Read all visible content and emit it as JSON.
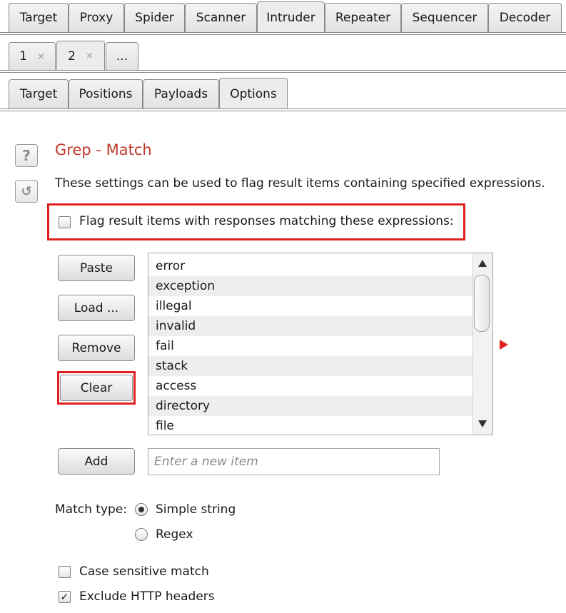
{
  "main_tabs": [
    "Target",
    "Proxy",
    "Spider",
    "Scanner",
    "Intruder",
    "Repeater",
    "Sequencer",
    "Decoder"
  ],
  "attack_tabs": [
    {
      "label": "1",
      "close": "×"
    },
    {
      "label": "2",
      "close": "×"
    },
    {
      "label": "..."
    }
  ],
  "sub_tabs": [
    "Target",
    "Positions",
    "Payloads",
    "Options"
  ],
  "section": {
    "title": "Grep - Match",
    "description": "These settings can be used to flag result items containing specified expressions.",
    "flag_label": "Flag result items with responses matching these expressions:"
  },
  "buttons": {
    "paste": "Paste",
    "load": "Load ...",
    "remove": "Remove",
    "clear": "Clear",
    "add": "Add"
  },
  "list_items": [
    "error",
    "exception",
    "illegal",
    "invalid",
    "fail",
    "stack",
    "access",
    "directory",
    "file"
  ],
  "new_item_placeholder": "Enter a new item",
  "match_type": {
    "label": "Match type:",
    "options": [
      "Simple string",
      "Regex"
    ],
    "selected": "Simple string"
  },
  "options": {
    "case_sensitive": "Case sensitive match",
    "exclude_headers": "Exclude HTTP headers"
  },
  "icons": {
    "help": "?",
    "reset": "↺",
    "check": "✓"
  }
}
